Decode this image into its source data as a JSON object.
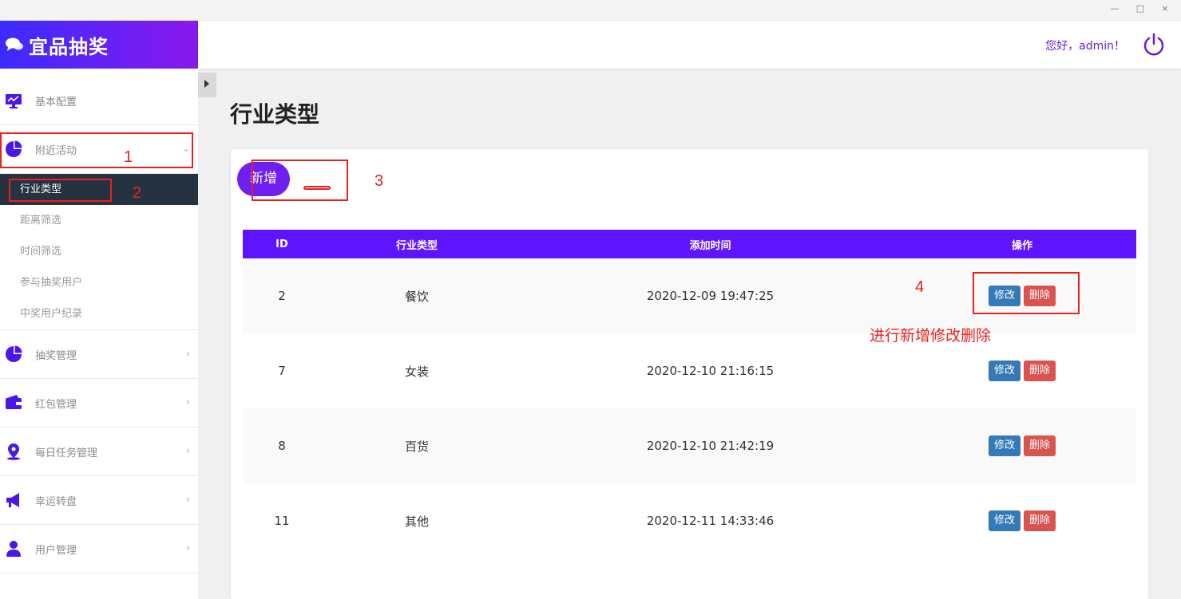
{
  "window": {
    "minimize": "—",
    "maximize": "□",
    "close": "×"
  },
  "brand": {
    "title": "宜品抽奖",
    "icon": "chat-bubbles-icon"
  },
  "header": {
    "greeting": "您好，admin！",
    "power_icon": "power-icon"
  },
  "sidebar": {
    "items": [
      {
        "label": "基本配置",
        "icon": "monitor-chart-icon"
      },
      {
        "label": "附近活动",
        "icon": "pie-chart-icon",
        "chevron": "⌄"
      },
      {
        "label": "抽奖管理",
        "icon": "pie-chart-icon",
        "chevron": "›"
      },
      {
        "label": "红包管理",
        "icon": "wallet-icon",
        "chevron": "›"
      },
      {
        "label": "每日任务管理",
        "icon": "map-pin-icon",
        "chevron": "›"
      },
      {
        "label": "幸运转盘",
        "icon": "megaphone-icon",
        "chevron": "›"
      },
      {
        "label": "用户管理",
        "icon": "user-icon",
        "chevron": "›"
      }
    ],
    "sub_items": [
      "行业类型",
      "距离筛选",
      "时间筛选",
      "参与抽奖用户",
      "中奖用户纪录"
    ]
  },
  "main": {
    "title": "行业类型",
    "add_button": "新增",
    "table": {
      "headers": [
        "ID",
        "行业类型",
        "添加时间",
        "操作"
      ],
      "rows": [
        {
          "id": "2",
          "type": "餐饮",
          "time": "2020-12-09 19:47:25"
        },
        {
          "id": "7",
          "type": "女装",
          "time": "2020-12-10 21:16:15"
        },
        {
          "id": "8",
          "type": "百货",
          "time": "2020-12-10 21:42:19"
        },
        {
          "id": "11",
          "type": "其他",
          "time": "2020-12-11 14:33:46"
        }
      ],
      "edit_label": "修改",
      "delete_label": "删除"
    }
  },
  "annotations": {
    "numbers": [
      "1",
      "2",
      "3",
      "4"
    ],
    "note": "进行新增修改删除"
  },
  "colors": {
    "accent": "#6f1ff0",
    "table_header": "#5f14ff",
    "active_sub": "#253340",
    "edit": "#337ab7",
    "delete": "#d9534f",
    "annotation": "#e8201f"
  }
}
